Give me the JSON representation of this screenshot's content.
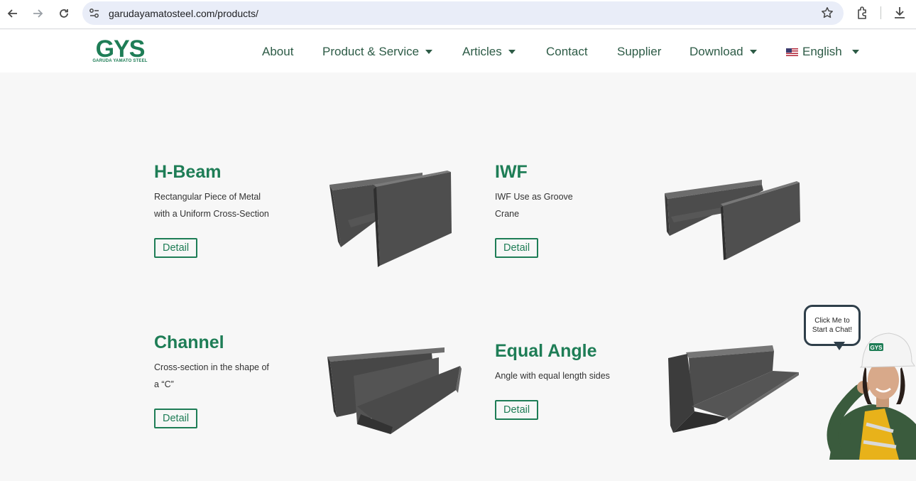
{
  "browser": {
    "url": "garudayamatosteel.com/products/"
  },
  "header": {
    "logo_text": "GYS",
    "logo_subtext": "GARUDA YAMATO STEEL",
    "nav": [
      {
        "label": "About",
        "has_dropdown": false
      },
      {
        "label": "Product & Service",
        "has_dropdown": true
      },
      {
        "label": "Articles",
        "has_dropdown": true
      },
      {
        "label": "Contact",
        "has_dropdown": false
      },
      {
        "label": "Supplier",
        "has_dropdown": false
      },
      {
        "label": "Download",
        "has_dropdown": true
      }
    ],
    "language": {
      "label": "English",
      "icon": "us-flag-icon"
    }
  },
  "products": [
    {
      "title": "H-Beam",
      "desc_line1": "Rectangular Piece of Metal",
      "desc_line2": "with a Uniform Cross-Section",
      "button": "Detail"
    },
    {
      "title": "IWF",
      "desc_line1": "IWF Use as Groove",
      "desc_line2": "Crane",
      "button": "Detail"
    },
    {
      "title": "Channel",
      "desc_line1": "Cross-section in the shape of",
      "desc_line2": "a “C”",
      "button": "Detail"
    },
    {
      "title": "Equal Angle",
      "desc_line1": "Angle with equal length sides",
      "desc_line2": "",
      "button": "Detail"
    }
  ],
  "chat": {
    "bubble_line1": "Click Me to",
    "bubble_line2": "Start a Chat!",
    "helmet_badge": "GYS"
  },
  "colors": {
    "brand_green": "#1e7d56",
    "nav_text": "#2d5b46",
    "page_bg": "#f7f7f7",
    "steel": "#4a4a4a"
  }
}
